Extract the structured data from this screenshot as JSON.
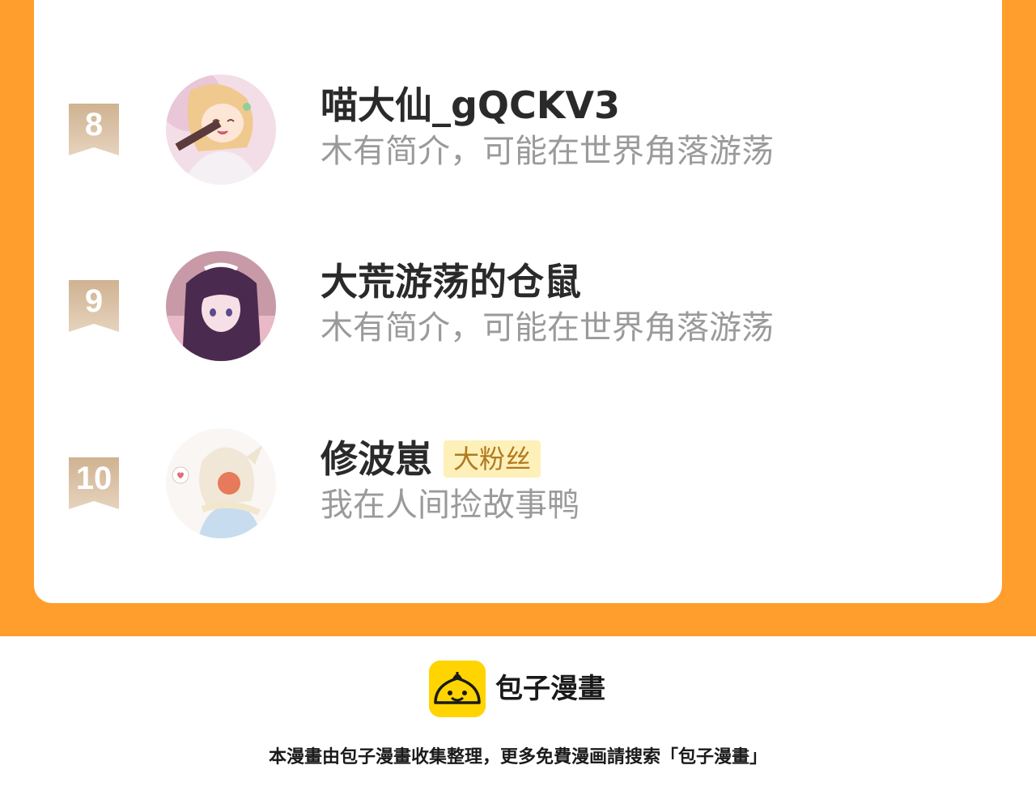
{
  "ranking": {
    "entries": [
      {
        "rank": "8",
        "name": "喵大仙_gQCKV3",
        "badge": "",
        "bio": "木有简介，可能在世界角落游荡"
      },
      {
        "rank": "9",
        "name": "大荒游荡的仓鼠",
        "badge": "",
        "bio": "木有简介，可能在世界角落游荡"
      },
      {
        "rank": "10",
        "name": "修波崽",
        "badge": "大粉丝",
        "bio": "我在人间捡故事鸭"
      }
    ]
  },
  "footer": {
    "brand": "包子漫畫",
    "notice": "本漫畫由包子漫畫收集整理，更多免費漫画請搜索「包子漫畫」"
  },
  "colors": {
    "frame": "#ff9e2c",
    "ribbon": "#d9c0a3",
    "badge_bg": "#fdf0b8",
    "badge_text": "#b07a22",
    "logo": "#ffd400"
  }
}
